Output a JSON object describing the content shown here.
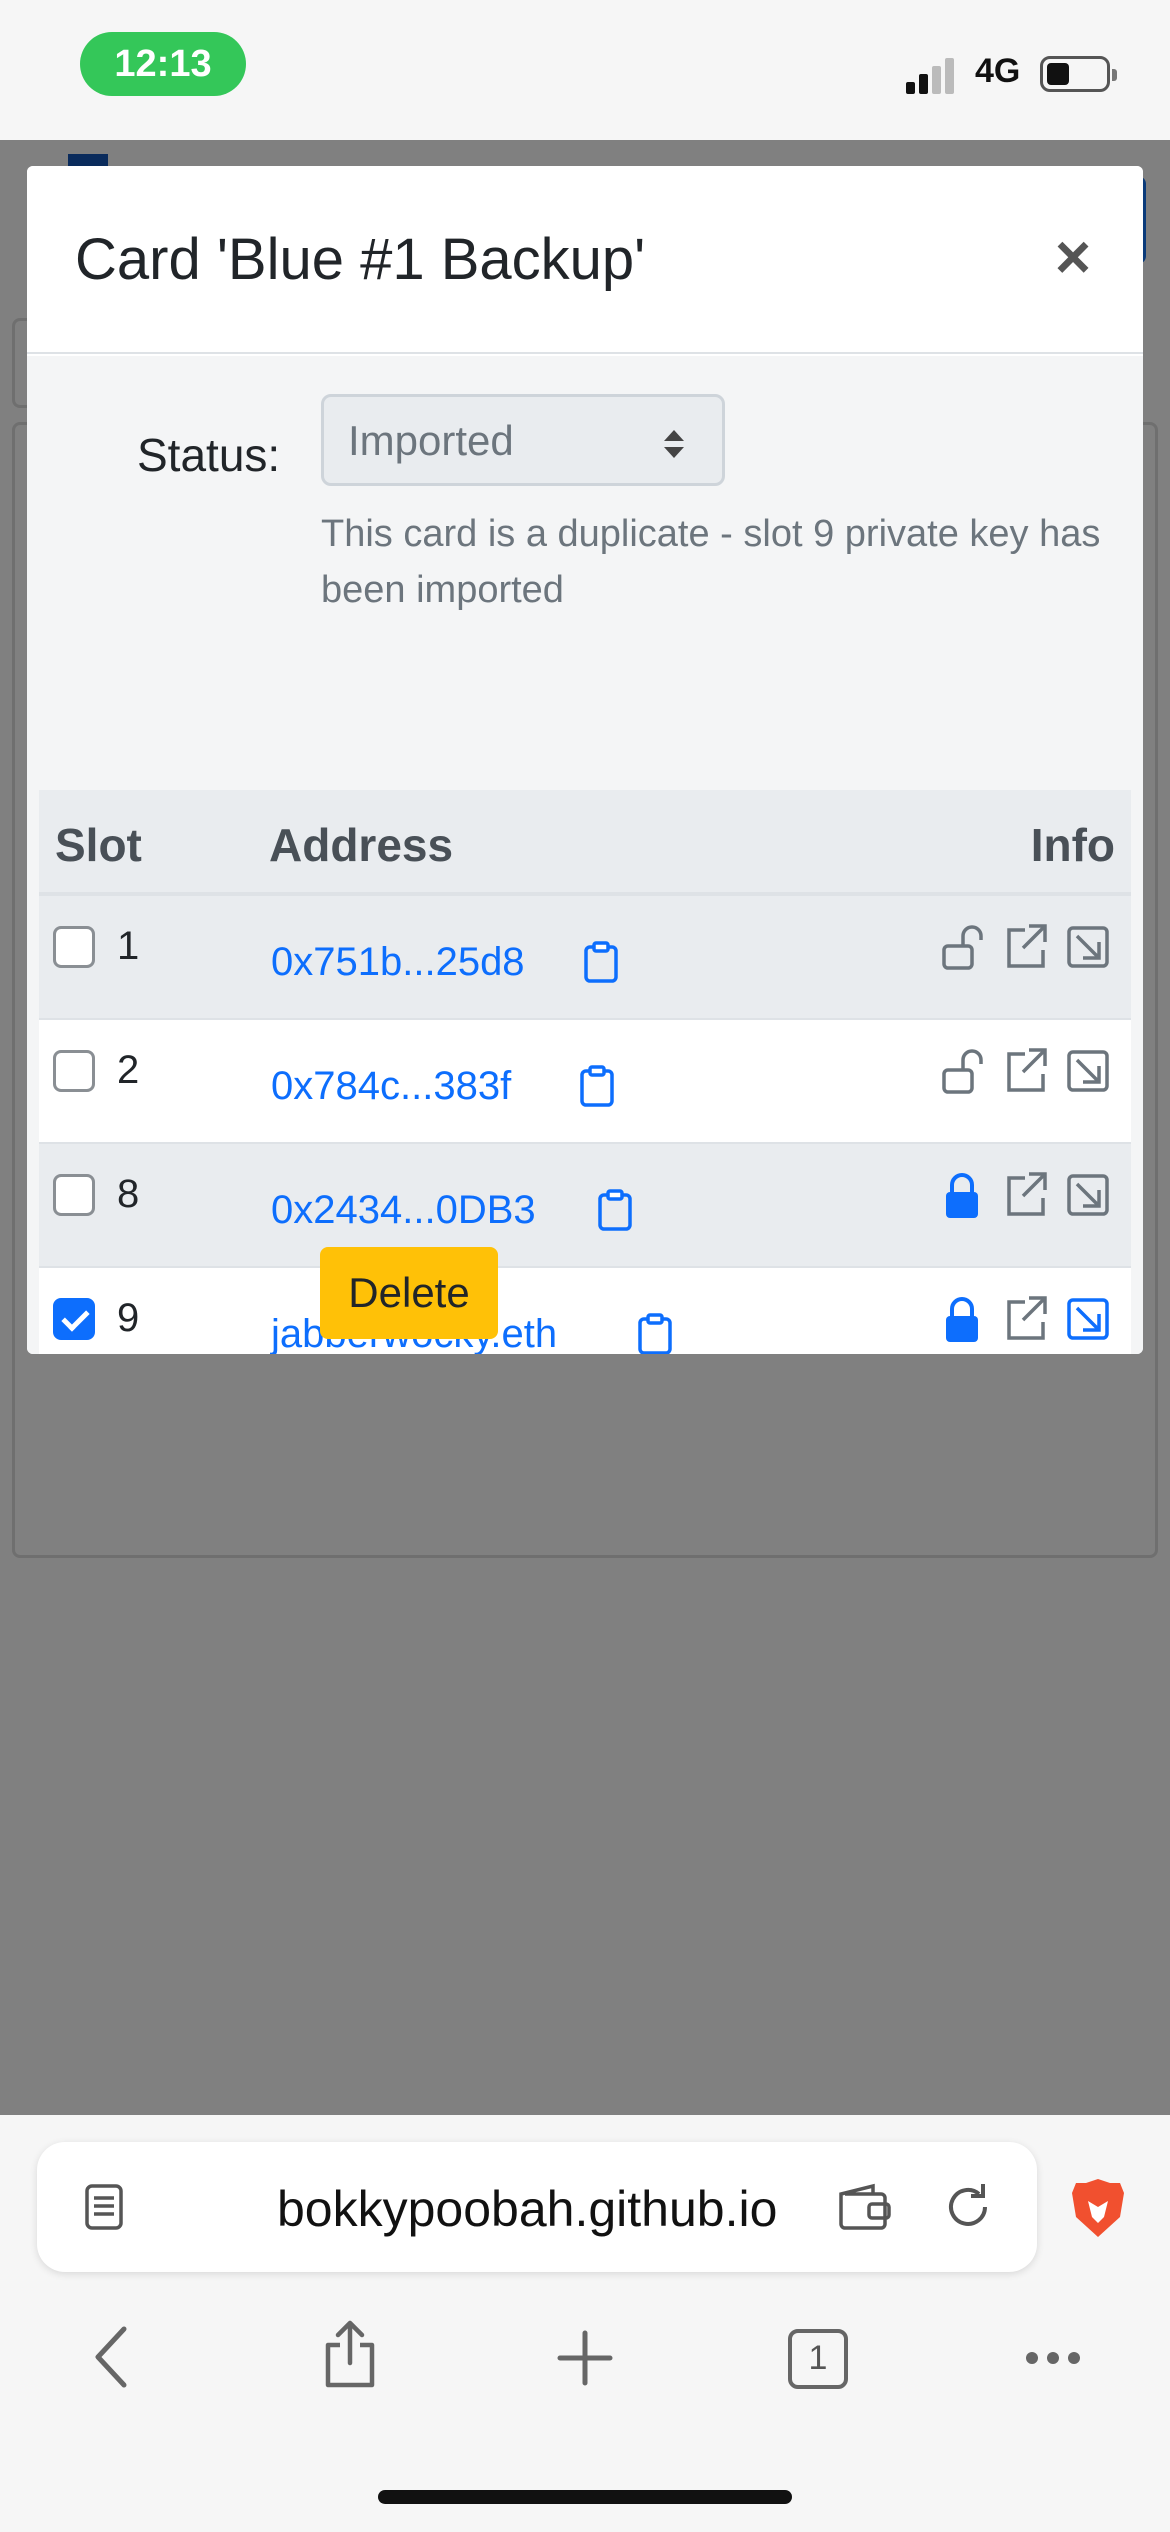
{
  "status_bar": {
    "time": "12:13",
    "network": "4G"
  },
  "modal": {
    "title": "Card 'Blue #1 Backup'",
    "close_glyph": "×",
    "status_label": "Status:",
    "status_value": "Imported",
    "hint": "This card is a duplicate - slot 9 private key has been imported",
    "table": {
      "headers": {
        "slot": "Slot",
        "address": "Address",
        "info": "Info"
      },
      "rows": [
        {
          "slot": "1",
          "address": "0x751b...25d8",
          "checked": false,
          "locked": false
        },
        {
          "slot": "2",
          "address": "0x784c...383f",
          "checked": false,
          "locked": false
        },
        {
          "slot": "8",
          "address": "0x2434...0DB3",
          "checked": false,
          "locked": true
        },
        {
          "slot": "9",
          "address": "jabberwocky.eth",
          "checked": true,
          "locked": true
        }
      ]
    },
    "delete_label": "Delete"
  },
  "browser": {
    "url": "bokkypoobah.github.io",
    "tab_count": "1",
    "icons": [
      "reader-icon",
      "wallet-icon",
      "reload-icon",
      "brave-lion-icon",
      "back-icon",
      "share-icon",
      "new-tab-icon",
      "tabs-icon",
      "more-icon"
    ]
  },
  "colors": {
    "link": "#0d6efd",
    "warning": "#ffc107",
    "status_pill": "#34c759"
  }
}
